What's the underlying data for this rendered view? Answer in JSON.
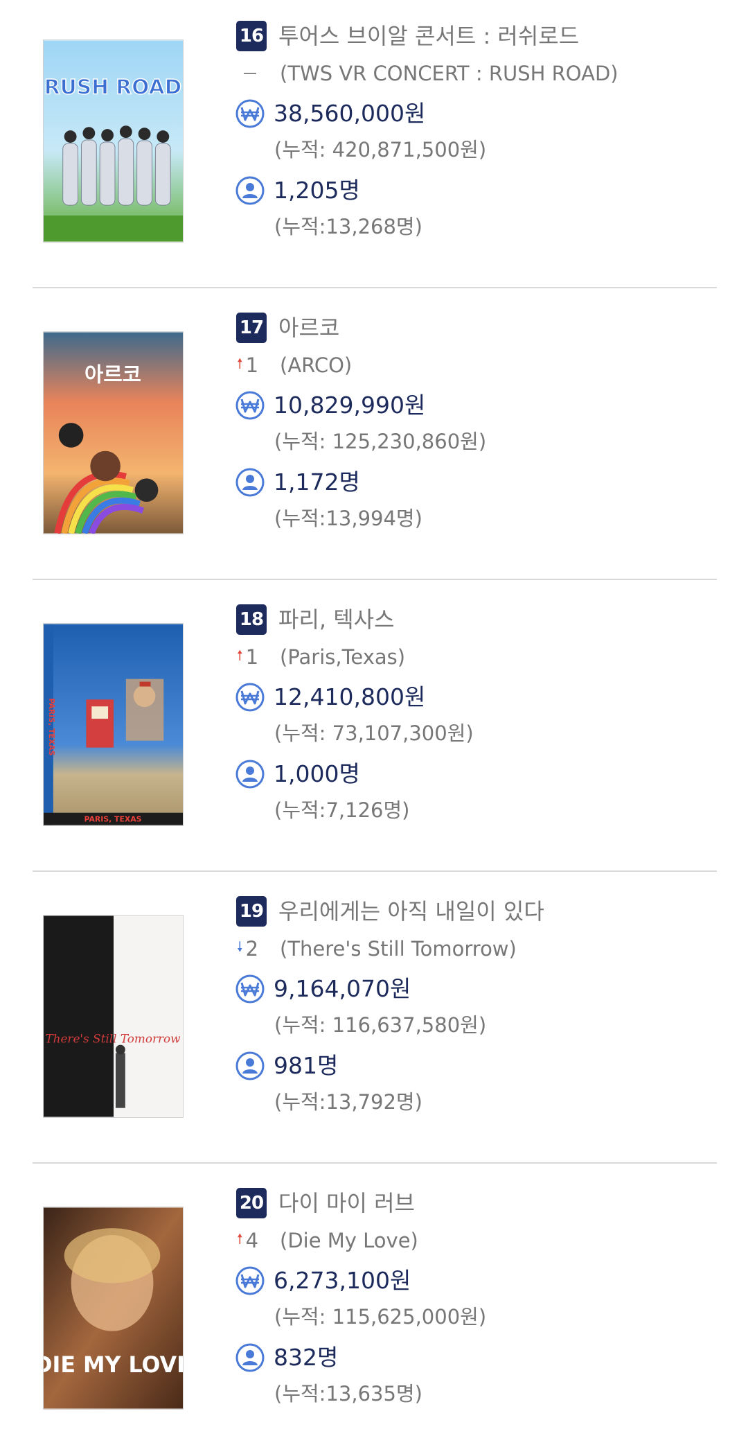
{
  "colors": {
    "badge": "#1c2a5c",
    "value_text": "#1c2a5c",
    "muted_text": "#777777",
    "icon_blue": "#4a7ad8",
    "rank_up": "#e0493e",
    "rank_down": "#4a7ad8"
  },
  "icons": {
    "sales": "won-circle-icon",
    "audience": "person-circle-icon",
    "rank_up": "arrow-up-icon",
    "rank_down": "arrow-down-icon",
    "no_change": "dash-icon"
  },
  "entries": [
    {
      "rank": "16",
      "title": "투어스 브이알 콘서트 : 러쉬로드",
      "original_title": "(TWS VR CONCERT : RUSH ROAD)",
      "change_dir": "same",
      "change": "",
      "sales": "38,560,000원",
      "sales_cum": "(누적: 420,871,500원)",
      "audience": "1,205명",
      "audience_cum": "(누적:13,268명)",
      "poster": {
        "text": "RUSH ROAD"
      }
    },
    {
      "rank": "17",
      "title": "아르코",
      "original_title": "(ARCO)",
      "change_dir": "up",
      "change": "1",
      "sales": "10,829,990원",
      "sales_cum": "(누적: 125,230,860원)",
      "audience": "1,172명",
      "audience_cum": "(누적:13,994명)",
      "poster": {
        "text": "아르코"
      }
    },
    {
      "rank": "18",
      "title": "파리, 텍사스",
      "original_title": "(Paris,Texas)",
      "change_dir": "up",
      "change": "1",
      "sales": "12,410,800원",
      "sales_cum": "(누적: 73,107,300원)",
      "audience": "1,000명",
      "audience_cum": "(누적:7,126명)",
      "poster": {
        "text": "PARIS, TEXAS"
      }
    },
    {
      "rank": "19",
      "title": "우리에게는 아직 내일이 있다",
      "original_title": "(There's Still Tomorrow)",
      "change_dir": "down",
      "change": "2",
      "sales": "9,164,070원",
      "sales_cum": "(누적: 116,637,580원)",
      "audience": "981명",
      "audience_cum": "(누적:13,792명)",
      "poster": {
        "text": "There's Still Tomorrow"
      }
    },
    {
      "rank": "20",
      "title": "다이 마이 러브",
      "original_title": "(Die My Love)",
      "change_dir": "up",
      "change": "4",
      "sales": "6,273,100원",
      "sales_cum": "(누적: 115,625,000원)",
      "audience": "832명",
      "audience_cum": "(누적:13,635명)",
      "poster": {
        "text": "DIE MY LOVE"
      }
    }
  ]
}
